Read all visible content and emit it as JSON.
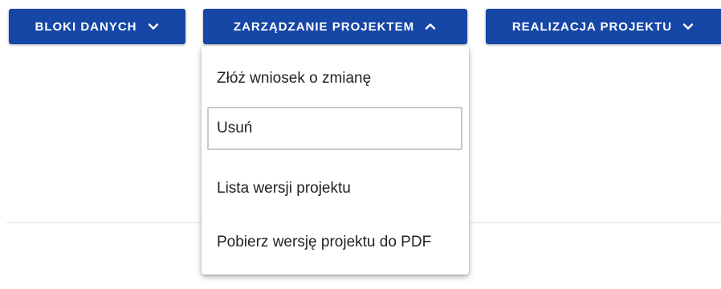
{
  "nav": {
    "buttons": [
      {
        "label": "BLOKI DANYCH",
        "icon": "chevron-down-icon"
      },
      {
        "label": "ZARZĄDZANIE PROJEKTEM",
        "icon": "chevron-up-icon"
      },
      {
        "label": "REALIZACJA PROJEKTU",
        "icon": "chevron-down-icon"
      }
    ]
  },
  "menu": {
    "items": [
      {
        "label": "Złóż wniosek o zmianę"
      },
      {
        "label": "Usuń"
      },
      {
        "label": "Lista wersji projektu"
      },
      {
        "label": "Pobierz wersję projektu do PDF"
      }
    ]
  },
  "colors": {
    "accent": "#1747a6",
    "text": "#222222",
    "focus_border": "#c8c8c8"
  }
}
